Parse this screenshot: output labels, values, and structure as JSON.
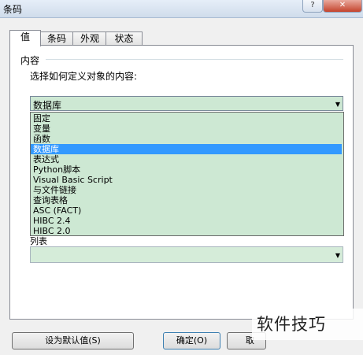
{
  "window": {
    "title": "条码",
    "help_label": "?",
    "close_label": "✕"
  },
  "tabs": [
    {
      "label": "值",
      "active": true
    },
    {
      "label": "条码",
      "active": false
    },
    {
      "label": "外观",
      "active": false
    },
    {
      "label": "状态",
      "active": false
    }
  ],
  "content": {
    "group_label": "内容",
    "prompt": "选择如何定义对象的内容:",
    "source_selected": "数据库",
    "source_options": [
      "固定",
      "变量",
      "函数",
      "数据库",
      "表达式",
      "Python脚本",
      "Visual Basic Script",
      "与文件链接",
      "查询表格",
      "ASC (FACT)",
      "HIBC 2.4",
      "HIBC 2.0"
    ],
    "source_highlighted_index": 3,
    "secondary_label": "列表",
    "secondary_value": ""
  },
  "buttons": {
    "set_default": "设为默认值(S)",
    "ok": "确定(O)",
    "cancel": "取"
  },
  "watermark": "软件技巧",
  "colors": {
    "field_bg": "#cde8d3",
    "selection": "#3399ff"
  }
}
